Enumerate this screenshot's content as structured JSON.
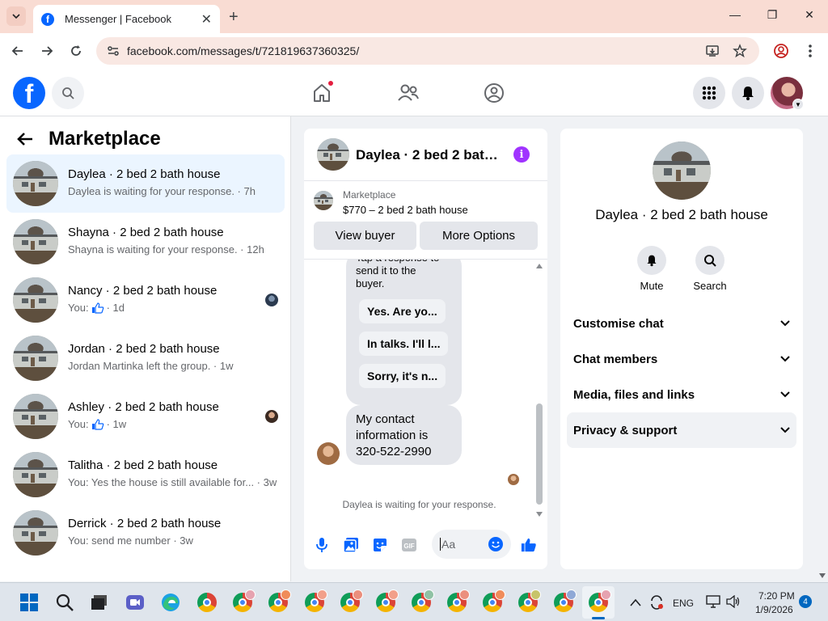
{
  "browser": {
    "tab_title": "Messenger | Facebook",
    "url": "facebook.com/messages/t/721819637360325/"
  },
  "left_panel": {
    "title": "Marketplace",
    "conversations": [
      {
        "name": "Daylea · 2 bed 2 bath house",
        "sub": "Daylea is waiting for your response. · 7h",
        "active": true
      },
      {
        "name": "Shayna · 2 bed 2 bath house",
        "sub": "Shayna is waiting for your response. · 12h"
      },
      {
        "name": "Nancy · 2 bed 2 bath house",
        "sub_prefix": "You:",
        "sub_suffix": "· 1d",
        "thumb_reaction": true
      },
      {
        "name": "Jordan · 2 bed 2 bath house",
        "sub": "Jordan Martinka left the group. · 1w"
      },
      {
        "name": "Ashley · 2 bed 2 bath house",
        "sub_prefix": "You:",
        "sub_suffix": "· 1w",
        "thumb_reaction": true
      },
      {
        "name": "Talitha · 2 bed 2 bath house",
        "sub": "You: Yes the house is still available for... · 3w"
      },
      {
        "name": "Derrick · 2 bed 2 bath house",
        "sub": "You: send me number · 3w"
      }
    ]
  },
  "chat": {
    "title": "Daylea · 2 bed 2 bath...",
    "listing_label": "Marketplace",
    "listing_price": "$770 – 2 bed 2 bath house",
    "view_buyer": "View buyer",
    "more_options": "More Options",
    "bubble_text": "Tap a response to send it to the buyer.",
    "quick_replies": [
      "Yes. Are yo...",
      "In talks. I'll l...",
      "Sorry, it's n..."
    ],
    "contact_message": "My contact information is 320-522-2990",
    "waiting_text": "Daylea is waiting for your response.",
    "composer_placeholder": "Aa"
  },
  "info_panel": {
    "name": "Daylea · 2 bed 2 bath house",
    "actions": [
      "Mute",
      "Search"
    ],
    "sections": [
      "Customise chat",
      "Chat members",
      "Media, files and links",
      "Privacy & support"
    ]
  },
  "taskbar": {
    "language": "ENG",
    "time": "7:20 PM",
    "date": "1/9/2026",
    "notification_count": "4"
  },
  "colors": {
    "facebook_blue": "#0866ff",
    "info_purple": "#a033ff",
    "active_conversation_bg": "#ebf5ff",
    "chrome_tab_strip": "#f9dcd3"
  }
}
